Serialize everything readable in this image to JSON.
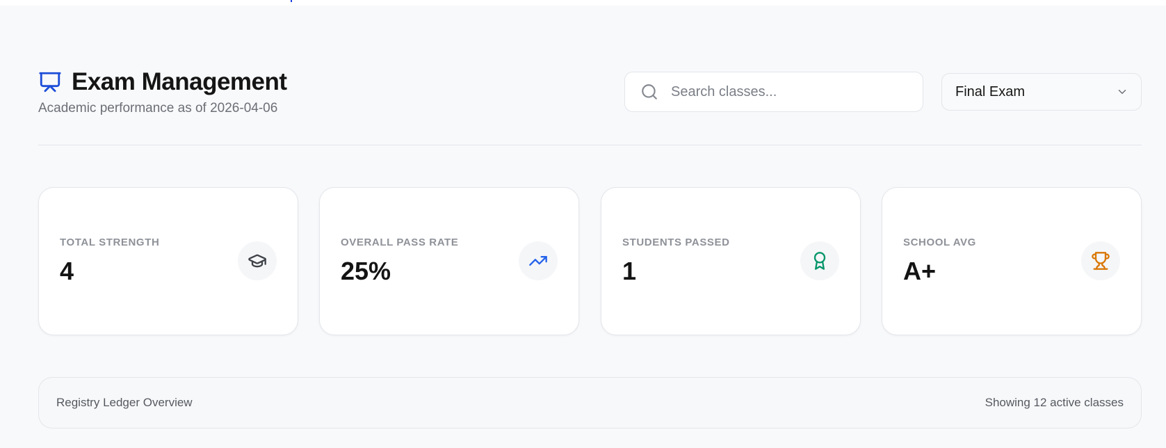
{
  "header": {
    "title": "Exam Management",
    "subtitle": "Academic performance as of 2026-04-06",
    "title_icon": "presentation-icon",
    "accent_color": "#1d4ed8"
  },
  "search": {
    "placeholder": "Search classes...",
    "value": "",
    "icon": "search-icon"
  },
  "exam_select": {
    "selected": "Final Exam",
    "icon": "chevron-down-icon"
  },
  "stats": [
    {
      "label": "TOTAL STRENGTH",
      "value": "4",
      "icon": "graduation-cap-icon",
      "icon_color": "#3f4248"
    },
    {
      "label": "OVERALL PASS RATE",
      "value": "25%",
      "icon": "trending-up-icon",
      "icon_color": "#2563eb"
    },
    {
      "label": "STUDENTS PASSED",
      "value": "1",
      "icon": "award-icon",
      "icon_color": "#059669"
    },
    {
      "label": "SCHOOL AVG",
      "value": "A+",
      "icon": "trophy-icon",
      "icon_color": "#d97706"
    }
  ],
  "ledger": {
    "title": "Registry Ledger Overview",
    "count_text": "Showing 12 active classes"
  }
}
